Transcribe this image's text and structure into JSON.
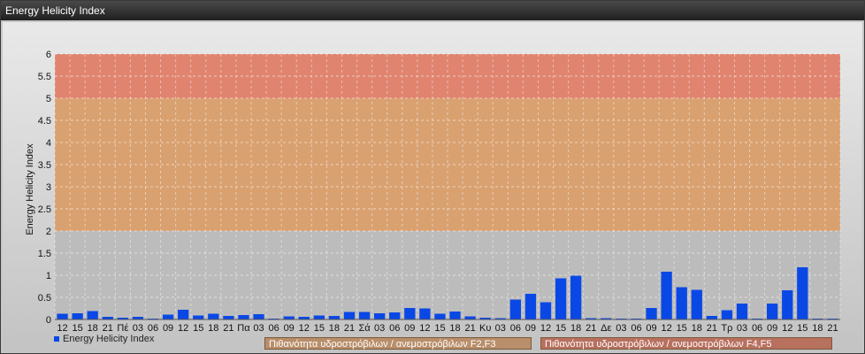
{
  "window": {
    "title": "Energy Helicity Index"
  },
  "chart_data": {
    "type": "bar",
    "ylabel": "Energy Helicity Index",
    "ylim": [
      0,
      6
    ],
    "y_ticks": [
      "0",
      "0.5",
      "1",
      "1.5",
      "2",
      "2.5",
      "3",
      "3.5",
      "4",
      "4.5",
      "5",
      "5.5",
      "6"
    ],
    "grid": true,
    "categories": [
      "12",
      "15",
      "18",
      "21",
      "Πέ",
      "03",
      "06",
      "09",
      "12",
      "15",
      "18",
      "21",
      "Πα",
      "03",
      "06",
      "09",
      "12",
      "15",
      "18",
      "21",
      "Σά",
      "03",
      "06",
      "09",
      "12",
      "15",
      "18",
      "21",
      "Κυ",
      "03",
      "06",
      "09",
      "12",
      "15",
      "18",
      "21",
      "Δε",
      "03",
      "06",
      "09",
      "12",
      "15",
      "18",
      "21",
      "Τρ",
      "03",
      "06",
      "09",
      "12",
      "15",
      "18",
      "21"
    ],
    "series": [
      {
        "name": "Energy Helicity Index",
        "values": [
          0.13,
          0.14,
          0.19,
          0.06,
          0.04,
          0.06,
          0.02,
          0.11,
          0.22,
          0.09,
          0.13,
          0.08,
          0.1,
          0.12,
          0.02,
          0.07,
          0.06,
          0.09,
          0.08,
          0.17,
          0.17,
          0.14,
          0.16,
          0.26,
          0.25,
          0.13,
          0.18,
          0.07,
          0.04,
          0.03,
          0.45,
          0.58,
          0.39,
          0.93,
          0.99,
          0.03,
          0.03,
          0.02,
          0.02,
          0.26,
          1.08,
          0.73,
          0.67,
          0.08,
          0.21,
          0.36,
          0.02,
          0.36,
          0.66,
          1.18,
          0.02,
          0.02
        ]
      }
    ],
    "bands": [
      {
        "from": 5,
        "to": 6,
        "color": "#e08470"
      },
      {
        "from": 2,
        "to": 5,
        "color": "#d9a170"
      },
      {
        "from": 0,
        "to": 2,
        "color": "#bcbcbc"
      }
    ],
    "series_color": "#0a48e6",
    "band_legend": [
      {
        "label": "Πιθανότητα υδροστρόβιλων / ανεμοστρόβιλων F2,F3",
        "color": "#b98e6a"
      },
      {
        "label": "Πιθανότητα υδροστρόβιλων / ανεμοστρόβιλων F4,F5",
        "color": "#b8705f"
      }
    ]
  }
}
